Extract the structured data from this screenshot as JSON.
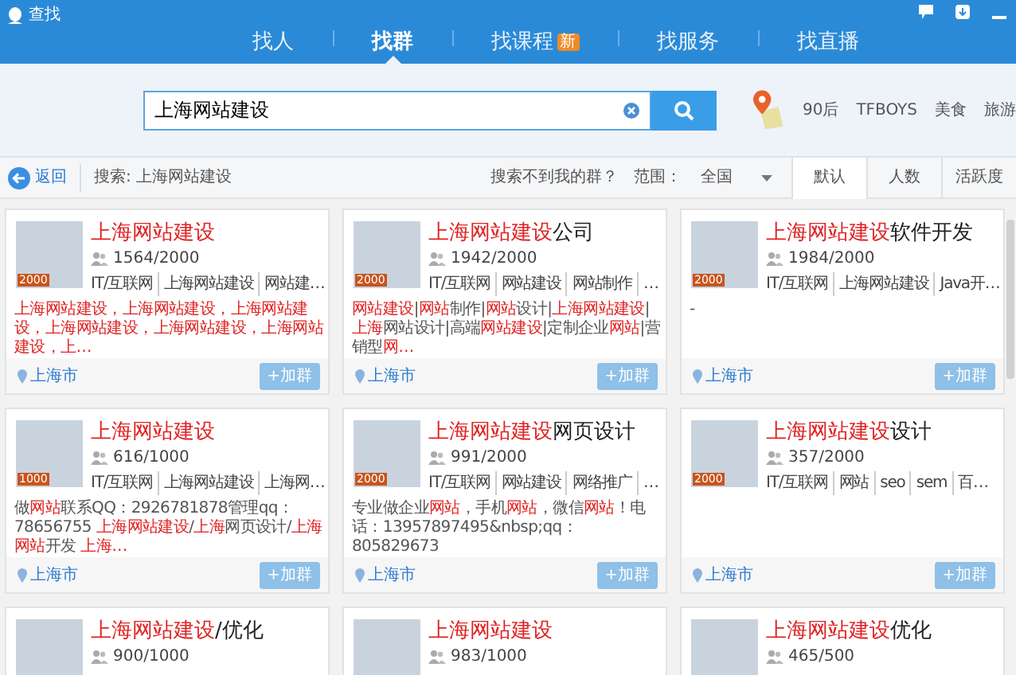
{
  "window": {
    "title": "查找"
  },
  "tabs": [
    {
      "label": "找人",
      "selected": false
    },
    {
      "label": "找群",
      "selected": true
    },
    {
      "label": "找课程",
      "selected": false,
      "badge": "新"
    },
    {
      "label": "找服务",
      "selected": false
    },
    {
      "label": "找直播",
      "selected": false
    }
  ],
  "search": {
    "value": "上海网站建设"
  },
  "hot_words": [
    "90后",
    "TFBOYS",
    "美食",
    "旅游"
  ],
  "toolbar": {
    "back": "返回",
    "query": "搜索: 上海网站建设",
    "help": "搜索不到我的群？",
    "scope_label": "范围：",
    "scope_value": "全国",
    "sort_tabs": [
      {
        "label": "默认",
        "selected": true
      },
      {
        "label": "人数",
        "selected": false
      },
      {
        "label": "活跃度",
        "selected": false
      }
    ]
  },
  "groups": [
    {
      "title": "**上海网站建设**",
      "badge": "2000",
      "members": "1564/2000",
      "tags": [
        "IT/互联网",
        "上海网站建设",
        "网站建…"
      ],
      "description": "**上海网站建设，上海网站建设，上海网站建设，上海网站建设，上海网站建设，上海网站建设，上…**",
      "location": "上海市",
      "join": "+加群"
    },
    {
      "title": "**上海网站建设**公司",
      "badge": "2000",
      "members": "1942/2000",
      "tags": [
        "IT/互联网",
        "网站建设",
        "网站制作",
        "…"
      ],
      "description": "**网站建设**|**网站**制作|**网站**设计|**上海网站建设**|**上海**网站设计|高端**网站建设**|定制企业**网站**|营销型**网…**",
      "location": "上海市",
      "join": "+加群"
    },
    {
      "title": "**上海网站建设**软件开发",
      "badge": "2000",
      "members": "1984/2000",
      "tags": [
        "IT/互联网",
        "上海网站建设",
        "Java开…"
      ],
      "description": "-",
      "location": "上海市",
      "join": "+加群"
    },
    {
      "title": "**上海网站建设**",
      "badge": "1000",
      "members": "616/1000",
      "tags": [
        "IT/互联网",
        "上海网站建设",
        "上海网…"
      ],
      "description": "做**网站**联系QQ：2926781878管理qq：78656755 **上海网站建设**/**上海**网页设计/**上海网站**开发 **上海…**",
      "location": "上海市",
      "join": "+加群"
    },
    {
      "title": "**上海网站建设**网页设计",
      "badge": "2000",
      "members": "991/2000",
      "tags": [
        "IT/互联网",
        "网站建设",
        "网络推广",
        "…"
      ],
      "description": "专业做企业**网站**，手机**网站**，微信**网站**！电话：13957897495&nbsp;qq：805829673",
      "location": "上海市",
      "join": "+加群"
    },
    {
      "title": "**上海网站建设**设计",
      "badge": "2000",
      "members": "357/2000",
      "tags": [
        "IT/互联网",
        "网站",
        "seo",
        "sem",
        "百…"
      ],
      "location": "上海市",
      "join": "+加群"
    },
    {
      "title": "**上海网站建设**/优化",
      "members": "900/1000"
    },
    {
      "title": "**上海网站建设**",
      "members": "983/1000"
    },
    {
      "title": "**上海网站建设**优化",
      "members": "465/500"
    }
  ]
}
